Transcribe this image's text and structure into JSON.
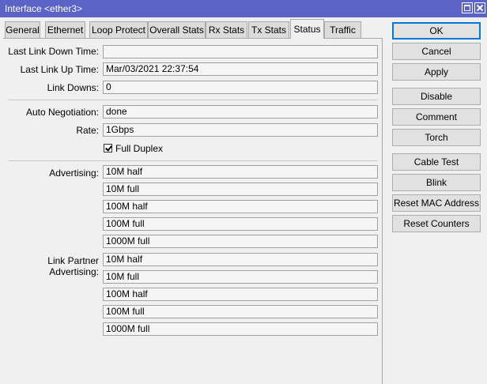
{
  "window": {
    "title": "Interface <ether3>"
  },
  "tabs": [
    "General",
    "Ethernet",
    "Loop Protect",
    "Overall Stats",
    "Rx Stats",
    "Tx Stats",
    "Status",
    "Traffic"
  ],
  "active_tab": "Status",
  "status": {
    "last_link_down_time": {
      "label": "Last Link Down Time:",
      "value": ""
    },
    "last_link_up_time": {
      "label": "Last Link Up Time:",
      "value": "Mar/03/2021 22:37:54"
    },
    "link_downs": {
      "label": "Link Downs:",
      "value": "0"
    },
    "auto_negotiation": {
      "label": "Auto Negotiation:",
      "value": "done"
    },
    "rate": {
      "label": "Rate:",
      "value": "1Gbps"
    },
    "full_duplex": {
      "label": "Full Duplex",
      "checked": true
    },
    "advertising": {
      "label": "Advertising:",
      "values": [
        "10M half",
        "10M full",
        "100M half",
        "100M full",
        "1000M full"
      ]
    },
    "link_partner_advertising": {
      "label": "Link Partner Advertising:",
      "values": [
        "10M half",
        "10M full",
        "100M half",
        "100M full",
        "1000M full"
      ]
    }
  },
  "buttons": {
    "ok": "OK",
    "cancel": "Cancel",
    "apply": "Apply",
    "disable": "Disable",
    "comment": "Comment",
    "torch": "Torch",
    "cable_test": "Cable Test",
    "blink": "Blink",
    "reset_mac": "Reset MAC Address",
    "reset_counters": "Reset Counters"
  },
  "colors": {
    "titlebar": "#5b63c6",
    "ok_border": "#0078d7"
  }
}
